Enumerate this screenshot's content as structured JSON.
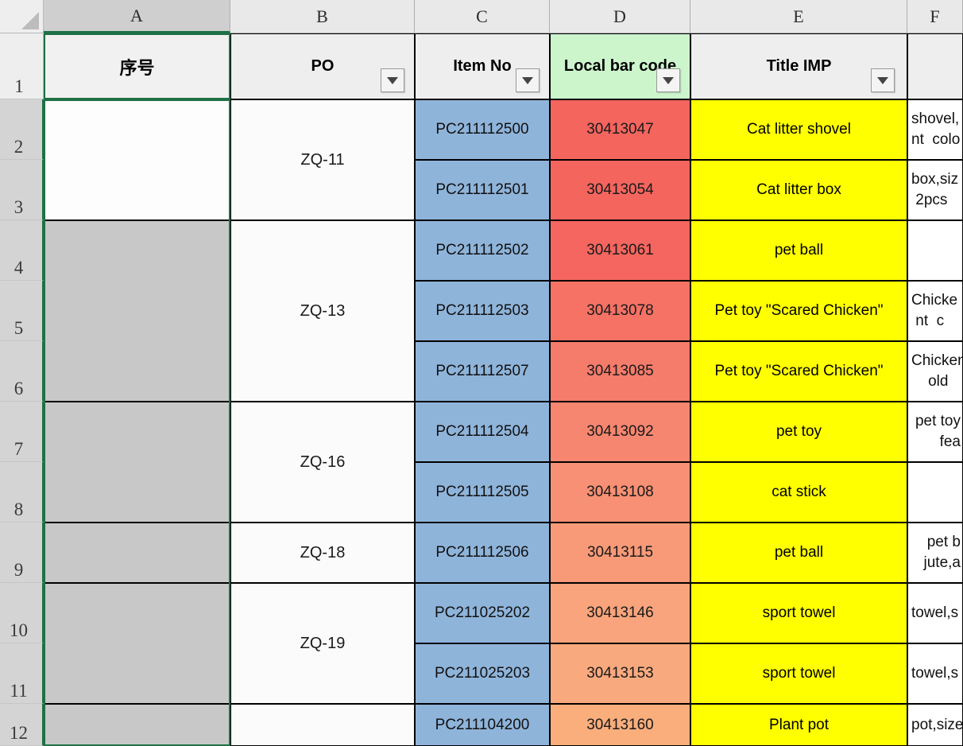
{
  "app": {
    "type": "spreadsheet",
    "select_all_corner": "select-all-triangle"
  },
  "columns": {
    "letters": [
      "A",
      "B",
      "C",
      "D",
      "E",
      "F"
    ],
    "selected_letter": "A"
  },
  "rows": {
    "numbers": [
      "1",
      "2",
      "3",
      "4",
      "5",
      "6",
      "7",
      "8",
      "9",
      "10",
      "11",
      "12"
    ],
    "selected_numbers": [
      "2",
      "3",
      "4",
      "5",
      "6",
      "7",
      "8",
      "9",
      "10",
      "11",
      "12"
    ]
  },
  "header_row": {
    "a": "序号",
    "b": "PO",
    "c": "Item No",
    "d": "Local bar code",
    "e": "Title IMP",
    "f": "",
    "filter_icon": "filter-dropdown-icon",
    "d_fill": "#ccf5cc",
    "default_fill": "#eeeeee"
  },
  "colors": {
    "accent_selection": "#1e7145",
    "item_no_fill": "#8fb4da",
    "title_fill": "#ffff00",
    "barcode_fills": [
      "#f4655e",
      "#f4655e",
      "#f4665f",
      "#f57265",
      "#f57b6b",
      "#f78670",
      "#f79074",
      "#f89a78",
      "#f9a47c",
      "#f9a97e",
      "#f9ae7c"
    ],
    "row_header_selected": "#d4d4d4",
    "col_a_selected_fill": "#fdfdfd",
    "col_a_unselected_fill": "#c8c8c8"
  },
  "table": {
    "po_groups": [
      {
        "label": "ZQ-11",
        "rows": 2
      },
      {
        "label": "ZQ-13",
        "rows": 3
      },
      {
        "label": "ZQ-16",
        "rows": 2
      },
      {
        "label": "ZQ-18",
        "rows": 1
      },
      {
        "label": "ZQ-19",
        "rows": 2
      },
      {
        "label": "",
        "rows": 1
      }
    ],
    "rows": [
      {
        "row": "2",
        "item_no": "PC211112500",
        "local_bar_code": "30413047",
        "title_imp": "Cat litter shovel",
        "desc_partial": "shovel,\nnt  colo"
      },
      {
        "row": "3",
        "item_no": "PC211112501",
        "local_bar_code": "30413054",
        "title_imp": "Cat litter box",
        "desc_partial": "box,siz\n 2pcs"
      },
      {
        "row": "4",
        "item_no": "PC211112502",
        "local_bar_code": "30413061",
        "title_imp": "pet ball",
        "desc_partial": ""
      },
      {
        "row": "5",
        "item_no": "PC211112503",
        "local_bar_code": "30413078",
        "title_imp": "Pet toy \"Scared Chicken\"",
        "desc_partial": "Chicke\n nt  c"
      },
      {
        "row": "6",
        "item_no": "PC211112507",
        "local_bar_code": "30413085",
        "title_imp": "Pet toy \"Scared Chicken\"",
        "desc_partial": "Chicken\n    old"
      },
      {
        "row": "7",
        "item_no": "PC211112504",
        "local_bar_code": "30413092",
        "title_imp": "pet toy",
        "desc_partial": "pet toy\n   fea"
      },
      {
        "row": "8",
        "item_no": "PC211112505",
        "local_bar_code": "30413108",
        "title_imp": "cat stick",
        "desc_partial": ""
      },
      {
        "row": "9",
        "item_no": "PC211112506",
        "local_bar_code": "30413115",
        "title_imp": "pet ball",
        "desc_partial": "   pet b\njute,a"
      },
      {
        "row": "10",
        "item_no": "PC211025202",
        "local_bar_code": "30413146",
        "title_imp": "sport towel",
        "desc_partial": "towel,s"
      },
      {
        "row": "11",
        "item_no": "PC211025203",
        "local_bar_code": "30413153",
        "title_imp": "sport towel",
        "desc_partial": "towel,s"
      },
      {
        "row": "12",
        "item_no": "PC211104200",
        "local_bar_code": "30413160",
        "title_imp": "Plant pot",
        "desc_partial": "pot,size"
      }
    ]
  }
}
